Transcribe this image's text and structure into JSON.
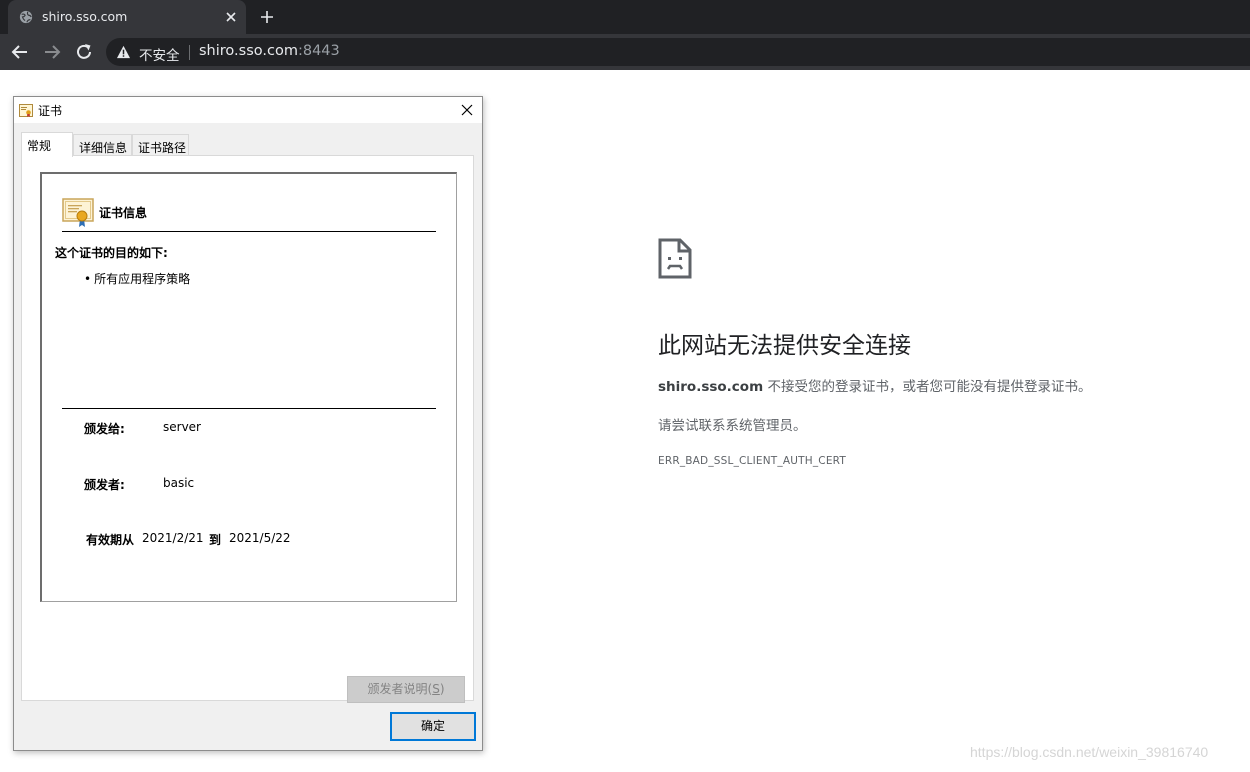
{
  "browser": {
    "tab_title": "shiro.sso.com",
    "security_label": "不安全",
    "url_host": "shiro.sso.com",
    "url_port": ":8443",
    "icons": [
      "globe-icon",
      "close-icon",
      "plus-icon",
      "back-icon",
      "forward-icon",
      "reload-icon",
      "warning-icon"
    ]
  },
  "error_page": {
    "icon": "sad-page-icon",
    "heading": "此网站无法提供安全连接",
    "desc_host": "shiro.sso.com",
    "desc_rest": " 不接受您的登录证书，或者您可能没有提供登录证书。",
    "suggestion": "请尝试联系系统管理员。",
    "error_code": "ERR_BAD_SSL_CLIENT_AUTH_CERT"
  },
  "watermark": "https://blog.csdn.net/weixin_39816740",
  "dialog": {
    "title": "证书",
    "tabs": [
      "常规",
      "详细信息",
      "证书路径"
    ],
    "active_tab": "常规",
    "cert_info_title": "证书信息",
    "purpose_heading": "这个证书的目的如下:",
    "purpose_items": [
      "所有应用程序策略"
    ],
    "issued_to_label": "颁发给:",
    "issued_to_value": "server",
    "issued_by_label": "颁发者:",
    "issued_by_value": "basic",
    "valid_from_label": "有效期从",
    "valid_from_value": "2021/2/21",
    "valid_to_label": "到",
    "valid_to_value": "2021/5/22",
    "issuer_statement_label": "颁发者说明(",
    "issuer_statement_key": "S",
    "issuer_statement_close": ")",
    "ok_label": "确定"
  }
}
